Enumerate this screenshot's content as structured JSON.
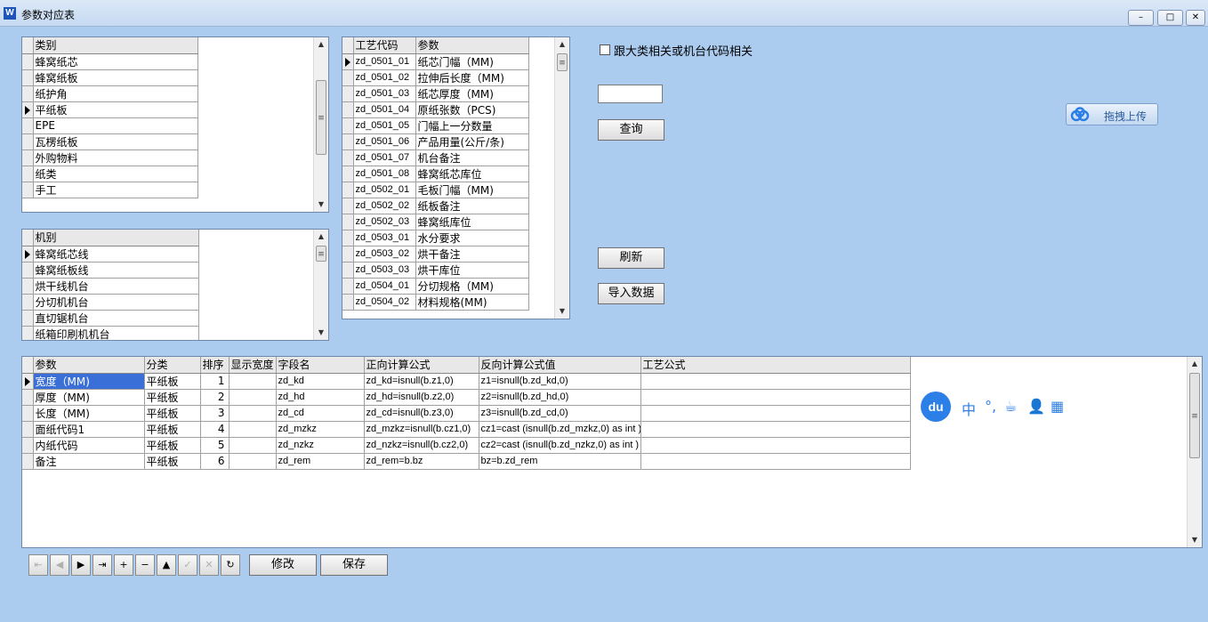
{
  "window": {
    "title": "参数对应表",
    "app_icon": "W",
    "minimize": "–",
    "maximize": "□",
    "close": "✕"
  },
  "category_grid": {
    "header": "类别",
    "current_row": 3,
    "rows": [
      "蜂窝纸芯",
      "蜂窝纸板",
      "纸护角",
      "平纸板",
      "EPE",
      "瓦楞纸板",
      "外购物料",
      "纸类",
      "手工"
    ]
  },
  "machine_grid": {
    "header": "机别",
    "current_row": 0,
    "rows": [
      "蜂窝纸芯线",
      "蜂窝纸板线",
      "烘干线机台",
      "分切机机台",
      "直切锯机台",
      "纸箱印刷机机台"
    ]
  },
  "process_grid": {
    "headers": [
      "工艺代码",
      "参数"
    ],
    "current_row": 0,
    "rows": [
      [
        "zd_0501_01",
        "纸芯门幅（MM)"
      ],
      [
        "zd_0501_02",
        "拉伸后长度（MM)"
      ],
      [
        "zd_0501_03",
        "纸芯厚度（MM)"
      ],
      [
        "zd_0501_04",
        "原纸张数（PCS)"
      ],
      [
        "zd_0501_05",
        "门幅上一分数量"
      ],
      [
        "zd_0501_06",
        "产品用量(公斤/条)"
      ],
      [
        "zd_0501_07",
        "机台备注"
      ],
      [
        "zd_0501_08",
        "蜂窝纸芯库位"
      ],
      [
        "zd_0502_01",
        "毛板门幅（MM)"
      ],
      [
        "zd_0502_02",
        "纸板备注"
      ],
      [
        "zd_0502_03",
        "蜂窝纸库位"
      ],
      [
        "zd_0503_01",
        "水分要求"
      ],
      [
        "zd_0503_02",
        "烘干备注"
      ],
      [
        "zd_0503_03",
        "烘干库位"
      ],
      [
        "zd_0504_01",
        "分切规格（MM)"
      ],
      [
        "zd_0504_02",
        "材料规格(MM)"
      ]
    ]
  },
  "options": {
    "checkbox_label": "跟大类相关或机台代码相关",
    "checkbox_checked": false,
    "search_value": "",
    "query_button": "查询",
    "refresh_button": "刷新",
    "import_button": "导入数据",
    "upload_label": "拖拽上传"
  },
  "param_grid": {
    "headers": [
      "参数",
      "分类",
      "排序",
      "显示宽度",
      "字段名",
      "正向计算公式",
      "反向计算公式值",
      "工艺公式"
    ],
    "current_row": 0,
    "rows": [
      [
        "宽度（MM)",
        "平纸板",
        "1",
        "",
        "zd_kd",
        "zd_kd=isnull(b.z1,0)",
        "z1=isnull(b.zd_kd,0)",
        ""
      ],
      [
        "厚度（MM)",
        "平纸板",
        "2",
        "",
        "zd_hd",
        "zd_hd=isnull(b.z2,0)",
        "z2=isnull(b.zd_hd,0)",
        ""
      ],
      [
        "长度（MM)",
        "平纸板",
        "3",
        "",
        "zd_cd",
        "zd_cd=isnull(b.z3,0)",
        "z3=isnull(b.zd_cd,0)",
        ""
      ],
      [
        "面纸代码1",
        "平纸板",
        "4",
        "",
        "zd_mzkz",
        "zd_mzkz=isnull(b.cz1,0)",
        "cz1=cast (isnull(b.zd_mzkz,0) as int )",
        ""
      ],
      [
        "内纸代码",
        "平纸板",
        "5",
        "",
        "zd_nzkz",
        "zd_nzkz=isnull(b.cz2,0)",
        "cz2=cast (isnull(b.zd_nzkz,0) as int )",
        ""
      ],
      [
        "备注",
        "平纸板",
        "6",
        "",
        "zd_rem",
        "zd_rem=b.bz",
        "bz=b.zd_rem",
        ""
      ]
    ]
  },
  "ime_toolbar": {
    "logo": "du",
    "items": [
      "中",
      "°,",
      "☕",
      "👤",
      "▦"
    ]
  },
  "navigator": {
    "buttons": [
      {
        "name": "first-record-button",
        "glyph": "⇤",
        "enabled": false
      },
      {
        "name": "prior-record-button",
        "glyph": "◀",
        "enabled": false
      },
      {
        "name": "next-record-button",
        "glyph": "▶",
        "enabled": true
      },
      {
        "name": "last-record-button",
        "glyph": "⇥",
        "enabled": true
      },
      {
        "name": "insert-record-button",
        "glyph": "+",
        "enabled": true
      },
      {
        "name": "delete-record-button",
        "glyph": "−",
        "enabled": true
      },
      {
        "name": "edit-record-button",
        "glyph": "▲",
        "enabled": true
      },
      {
        "name": "post-record-button",
        "glyph": "✓",
        "enabled": false
      },
      {
        "name": "cancel-edit-button",
        "glyph": "✕",
        "enabled": false
      },
      {
        "name": "refresh-data-button",
        "glyph": "↻",
        "enabled": true
      }
    ],
    "modify_button": "修改",
    "save_button": "保存"
  }
}
